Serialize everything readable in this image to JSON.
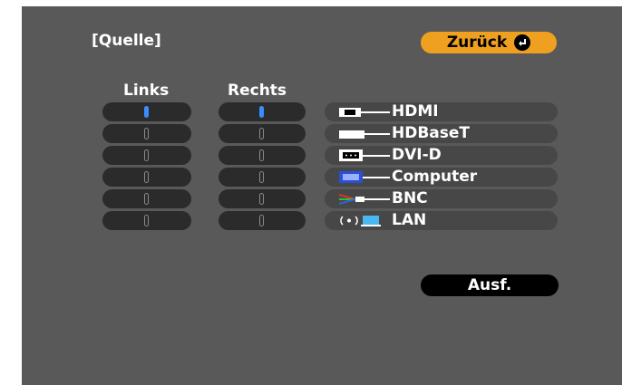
{
  "title": "[Quelle]",
  "back_button": {
    "label": "Zurück"
  },
  "columns": {
    "left": "Links",
    "right": "Rechts"
  },
  "rows": [
    {
      "left_selected": true,
      "right_selected": true
    },
    {
      "left_selected": false,
      "right_selected": false
    },
    {
      "left_selected": false,
      "right_selected": false
    },
    {
      "left_selected": false,
      "right_selected": false
    },
    {
      "left_selected": false,
      "right_selected": false
    },
    {
      "left_selected": false,
      "right_selected": false
    }
  ],
  "sources": [
    {
      "label": "HDMI",
      "icon": "hdmi-icon"
    },
    {
      "label": "HDBaseT",
      "icon": "hdbaset-icon"
    },
    {
      "label": "DVI-D",
      "icon": "dvi-icon"
    },
    {
      "label": "Computer",
      "icon": "computer-icon"
    },
    {
      "label": "BNC",
      "icon": "bnc-icon"
    },
    {
      "label": "LAN",
      "icon": "lan-icon"
    }
  ],
  "execute_button": {
    "label": "Ausf."
  },
  "colors": {
    "background": "#595959",
    "accent": "#f0a020",
    "selected": "#3c8cff"
  }
}
